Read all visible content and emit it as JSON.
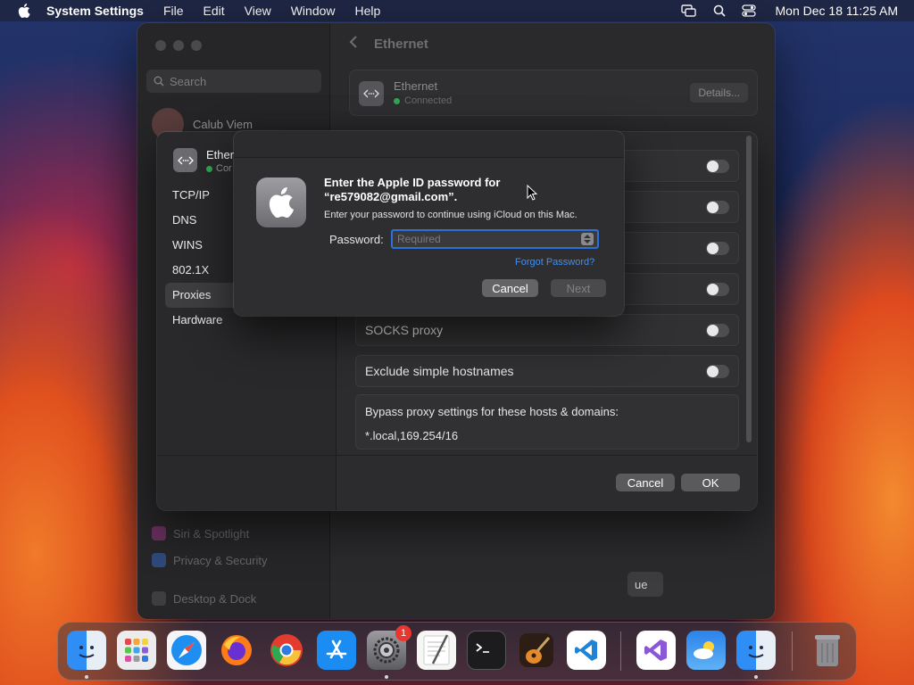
{
  "menubar": {
    "app_name": "System Settings",
    "items": [
      "File",
      "Edit",
      "View",
      "Window",
      "Help"
    ],
    "clock": "Mon Dec 18  11:25 AM"
  },
  "settings": {
    "search_placeholder": "Search",
    "user_name": "Calub Viem",
    "header_title": "Ethernet",
    "card_title": "Ethernet",
    "card_status": "Connected",
    "details_label": "Details...",
    "lower_items": [
      "Siri & Spotlight",
      "Privacy & Security",
      "Desktop & Dock"
    ],
    "continue_label": "ue"
  },
  "sheet": {
    "eth_name": "Ether",
    "eth_status": "Cor",
    "nav": [
      "TCP/IP",
      "DNS",
      "WINS",
      "802.1X",
      "Proxies",
      "Hardware"
    ],
    "selected_nav": "Proxies",
    "rows": [
      "",
      "",
      "",
      "",
      "SOCKS proxy",
      "Exclude simple hostnames"
    ],
    "bypass_label": "Bypass proxy settings for these hosts & domains:",
    "bypass_value": "*.local,169.254/16",
    "cancel_label": "Cancel",
    "ok_label": "OK"
  },
  "dialog": {
    "title_line1": "Enter the Apple ID password for",
    "title_line2": "“re579082@gmail.com”.",
    "subtitle": "Enter your password to continue using iCloud on this Mac.",
    "password_label": "Password:",
    "password_placeholder": "Required",
    "forgot_label": "Forgot Password?",
    "cancel_label": "Cancel",
    "next_label": "Next"
  },
  "dock": {
    "items": [
      "finder-icon",
      "launchpad-icon",
      "safari-icon",
      "firefox-icon",
      "chrome-icon",
      "app-store-icon",
      "system-settings-icon",
      "textedit-icon",
      "terminal-icon",
      "garageband-icon",
      "vscode-icon",
      "visual-studio-icon",
      "weather-icon",
      "finder-window-icon",
      "trash-icon"
    ],
    "settings_badge": "1"
  },
  "colors": {
    "accent": "#2a72d9",
    "link": "#3f8ff0",
    "badge": "#e9372f"
  }
}
